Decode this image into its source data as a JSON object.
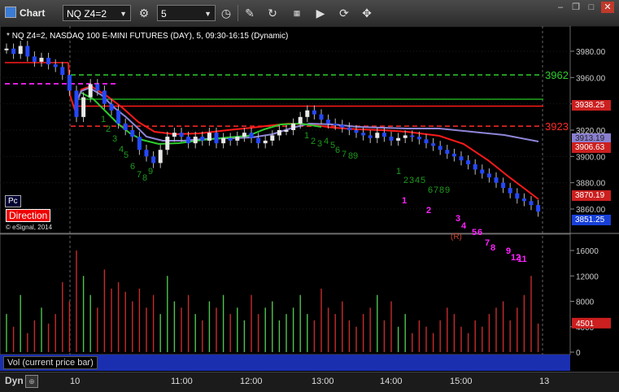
{
  "window": {
    "title": "Chart"
  },
  "toolbar": {
    "symbol": "NQ Z4=2",
    "interval": "5"
  },
  "header": {
    "title": "NQ Z4=2, NASDAQ 100 E-MINI FUTURES (DAY), 5, 09:30-16:15 (Dynamic)"
  },
  "overlay": {
    "pc_label": "Pc",
    "direction_label": "Direction",
    "copyright": "© eSignal, 2014",
    "r_marker": "(R)"
  },
  "price_axis": {
    "ticks": [
      "3980.00",
      "3960.00",
      "3940.00",
      "3920.00",
      "3900.00",
      "3880.00",
      "3860.00"
    ]
  },
  "price_levels": {
    "green_level": "3962",
    "red_level": "3923",
    "labels": [
      {
        "value": "3938.25",
        "bg": "#cc1f1f",
        "fg": "#ffffff"
      },
      {
        "value": "3913.19",
        "bg": "#8a7fd0",
        "fg": "#222222"
      },
      {
        "value": "3906.63",
        "bg": "#cc1f1f",
        "fg": "#ffffff"
      },
      {
        "value": "3870.19",
        "bg": "#cc1f1f",
        "fg": "#ffffff"
      },
      {
        "value": "3851.25",
        "bg": "#1840d8",
        "fg": "#ffffff"
      }
    ]
  },
  "volume": {
    "label": "Vol (current price bar)",
    "axis_ticks": [
      "16000",
      "12000",
      "8000",
      "4000",
      "0"
    ],
    "current": "4501",
    "current_bg": "#cc1f1f"
  },
  "time_axis": {
    "labels": [
      "10",
      "11:00",
      "12:00",
      "13:00",
      "14:00",
      "15:00",
      "13"
    ]
  },
  "bottom": {
    "mode": "Dyn"
  },
  "colors": {
    "up_bar": "#e8e8e8",
    "down_bar": "#2448ff",
    "ma_green": "#2ccd2c",
    "ma_red": "#ff1a1a",
    "level_green": "#2ccd2c",
    "level_red": "#ff2a2a",
    "magenta": "#ff22ff",
    "count_green": "#1e9a1e"
  },
  "counts": {
    "green": [
      {
        "t": "1",
        "s": 1
      },
      {
        "t": "2",
        "s": 1
      },
      {
        "t": "3",
        "s": 1
      },
      {
        "t": "4",
        "s": 1
      },
      {
        "t": "5",
        "s": 1
      },
      {
        "t": "6",
        "s": 1
      },
      {
        "t": "7",
        "s": 1
      },
      {
        "t": "8",
        "s": 1
      },
      {
        "t": "9",
        "s": 1
      },
      {
        "t": "1",
        "s": 2
      },
      {
        "t": "2",
        "s": 2
      },
      {
        "t": "3",
        "s": 2
      },
      {
        "t": "4",
        "s": 2
      },
      {
        "t": "5",
        "s": 2
      },
      {
        "t": "6",
        "s": 2
      },
      {
        "t": "7",
        "s": 2
      },
      {
        "t": "8",
        "s": 2
      },
      {
        "t": "9",
        "s": 2
      },
      {
        "t": "1",
        "s": 3
      },
      {
        "t": "2",
        "s": 3
      },
      {
        "t": "3",
        "s": 3
      },
      {
        "t": "4",
        "s": 3
      },
      {
        "t": "5",
        "s": 3
      },
      {
        "t": "6",
        "s": 3
      },
      {
        "t": "7",
        "s": 3
      },
      {
        "t": "8",
        "s": 3
      },
      {
        "t": "9",
        "s": 3
      }
    ],
    "magenta": [
      {
        "t": "1"
      },
      {
        "t": "2"
      },
      {
        "t": "3"
      },
      {
        "t": "4"
      },
      {
        "t": "5"
      },
      {
        "t": "6"
      },
      {
        "t": "7"
      },
      {
        "t": "8"
      },
      {
        "t": "9"
      },
      {
        "t": "12"
      },
      {
        "t": "11"
      }
    ]
  }
}
